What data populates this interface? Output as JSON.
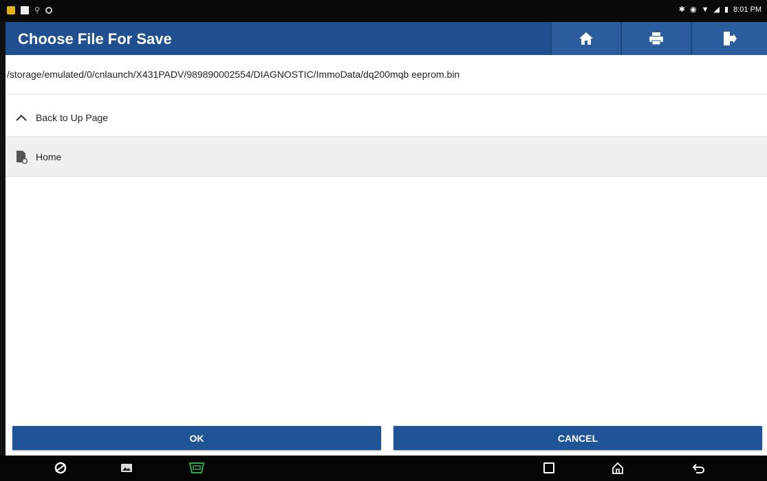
{
  "status_bar": {
    "time": "8:01 PM",
    "icons_left": [
      "notification-icon",
      "image-icon",
      "usb-icon",
      "settings-circle-icon"
    ],
    "icons_right": [
      "bluetooth-icon",
      "alarm-icon",
      "wifi-icon",
      "signal-icon",
      "battery-icon"
    ]
  },
  "header": {
    "title": "Choose File For Save",
    "buttons": [
      "home-icon",
      "print-icon",
      "exit-icon"
    ],
    "background": "#1f4f8e"
  },
  "path": "/storage/emulated/0/cnlaunch/X431PADV/989890002554/DIAGNOSTIC/ImmoData/dq200mqb eeprom.bin",
  "list": [
    {
      "label": "Back to Up Page",
      "icon": "chevron-up-icon"
    },
    {
      "label": "Home",
      "icon": "file-icon"
    }
  ],
  "actions": {
    "ok_label": "OK",
    "cancel_label": "CANCEL",
    "color": "#1f5596"
  },
  "nav_bar": {
    "items": [
      "browser-icon",
      "gallery-icon",
      "obd-connector-icon",
      "recents-icon",
      "home-nav-icon",
      "back-icon"
    ]
  }
}
